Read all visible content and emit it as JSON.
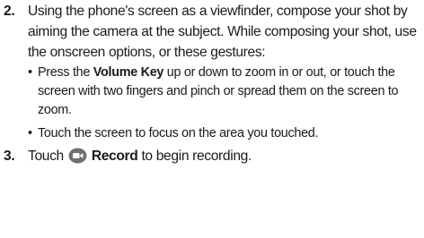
{
  "steps": [
    {
      "number": "2.",
      "text": "Using the phone's screen as a viewfinder, compose your shot by aiming the camera at the subject. While composing your shot, use the onscreen options, or these gestures:",
      "bullets": [
        {
          "pre": "Press the ",
          "bold": "Volume Key",
          "post": " up or down to zoom in or out, or touch the screen with two fingers and pinch or spread them on the screen to zoom."
        },
        {
          "text": "Touch the screen to focus on the area you touched."
        }
      ]
    },
    {
      "number": "3.",
      "pre": "Touch ",
      "icon": "record-camcorder-icon",
      "bold": "Record",
      "post": " to begin recording."
    }
  ],
  "colors": {
    "text": "#1a1a1a",
    "icon_bg": "#6f6f6f",
    "icon_fg": "#ffffff"
  }
}
